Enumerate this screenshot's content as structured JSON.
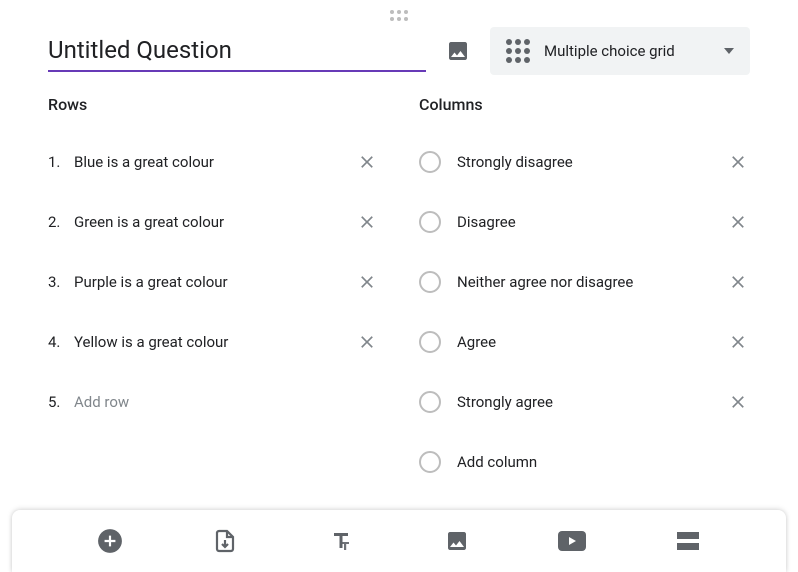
{
  "question": {
    "title": "Untitled Question"
  },
  "typeSelector": {
    "label": "Multiple choice grid"
  },
  "rowsSection": {
    "title": "Rows"
  },
  "columnsSection": {
    "title": "Columns"
  },
  "rows": [
    {
      "num": "1.",
      "text": "Blue is a great colour"
    },
    {
      "num": "2.",
      "text": "Green is a great colour"
    },
    {
      "num": "3.",
      "text": "Purple is a great colour"
    },
    {
      "num": "4.",
      "text": "Yellow is a great colour"
    }
  ],
  "addRow": {
    "num": "5.",
    "placeholder": "Add row"
  },
  "columns": [
    {
      "text": "Strongly disagree"
    },
    {
      "text": "Disagree"
    },
    {
      "text": "Neither agree nor disagree"
    },
    {
      "text": "Agree"
    },
    {
      "text": "Strongly agree"
    }
  ],
  "addColumn": {
    "placeholder": "Add column"
  },
  "colors": {
    "accent": "#673ab7"
  }
}
